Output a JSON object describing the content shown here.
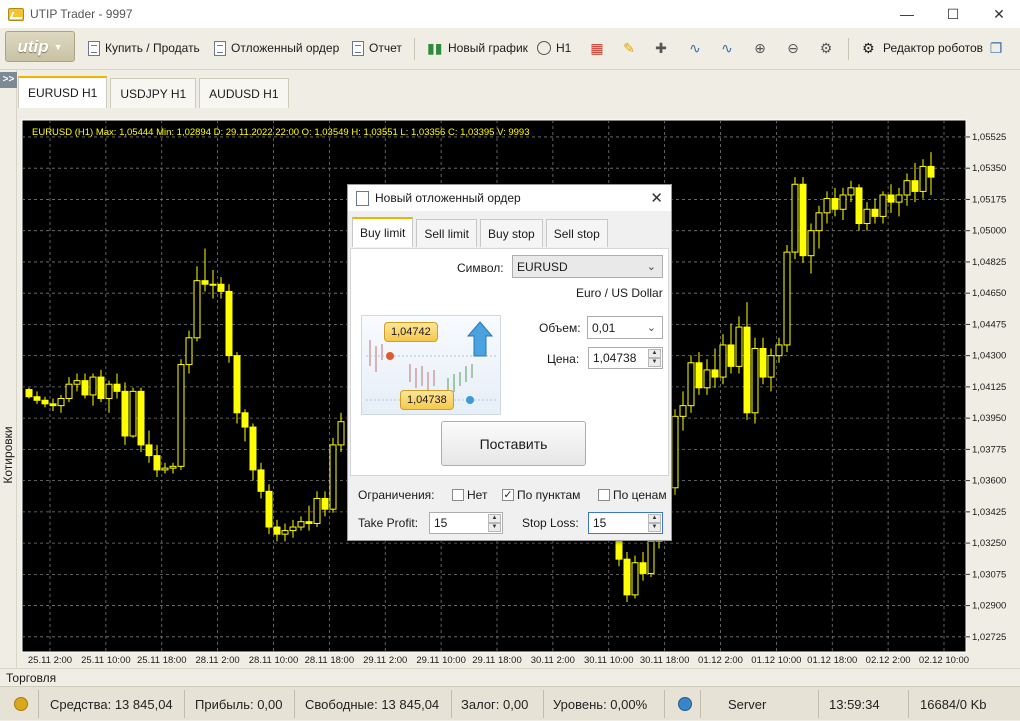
{
  "window": {
    "title": "UTIP Trader - 9997"
  },
  "toolbar": {
    "logo": "utip",
    "buy_sell": "Купить / Продать",
    "pending_order": "Отложенный ордер",
    "report": "Отчет",
    "new_chart": "Новый график",
    "timeframe": "H1",
    "robot_editor": "Редактор роботов"
  },
  "sidebar": {
    "quotes_label": "Котировки"
  },
  "tabs": [
    {
      "label": "EURUSD  H1"
    },
    {
      "label": "USDJPY  H1"
    },
    {
      "label": "AUDUSD  H1"
    }
  ],
  "chart_info": "EURUSD (H1)  Max: 1,05444  Min: 1,02894  D: 29.11.2022 22:00  O: 1,03549  H: 1,03551  L: 1,03356  C: 1,03395  V: 9993",
  "chart_data": {
    "type": "candlestick",
    "symbol": "EURUSD",
    "timeframe": "H1",
    "ylim": [
      1.0264,
      1.0562
    ],
    "y_ticks": [
      "1,05525",
      "1,05350",
      "1,05175",
      "1,05000",
      "1,04825",
      "1,04650",
      "1,04475",
      "1,04300",
      "1,04125",
      "1,03950",
      "1,03775",
      "1,03600",
      "1,03425",
      "1,03250",
      "1,03075",
      "1,02900",
      "1,02725"
    ],
    "y_tick_values": [
      1.05525,
      1.0535,
      1.05175,
      1.05,
      1.04825,
      1.0465,
      1.04475,
      1.043,
      1.04125,
      1.0395,
      1.03775,
      1.036,
      1.03425,
      1.0325,
      1.03075,
      1.029,
      1.02725
    ],
    "x_ticks": [
      "25.11 2:00",
      "25.11 10:00",
      "25.11 18:00",
      "28.11 2:00",
      "28.11 10:00",
      "28.11 18:00",
      "29.11 2:00",
      "29.11 10:00",
      "29.11 18:00",
      "30.11 2:00",
      "30.11 10:00",
      "30.11 18:00",
      "01.12 2:00",
      "01.12 10:00",
      "01.12 18:00",
      "02.12 2:00",
      "02.12 10:00"
    ],
    "grid": true,
    "candles": [
      [
        1.0411,
        1.0412,
        1.0406,
        1.0407
      ],
      [
        1.0407,
        1.041,
        1.0403,
        1.0405
      ],
      [
        1.0405,
        1.0407,
        1.0401,
        1.0403
      ],
      [
        1.0403,
        1.0406,
        1.0399,
        1.0402
      ],
      [
        1.0402,
        1.0408,
        1.0398,
        1.0406
      ],
      [
        1.0406,
        1.0418,
        1.0404,
        1.0414
      ],
      [
        1.0414,
        1.042,
        1.041,
        1.0416
      ],
      [
        1.0416,
        1.042,
        1.0406,
        1.0408
      ],
      [
        1.0408,
        1.042,
        1.0402,
        1.0418
      ],
      [
        1.0418,
        1.0422,
        1.0404,
        1.0406
      ],
      [
        1.0406,
        1.0416,
        1.0398,
        1.0414
      ],
      [
        1.0414,
        1.042,
        1.0406,
        1.041
      ],
      [
        1.041,
        1.0415,
        1.038,
        1.0385
      ],
      [
        1.0385,
        1.0412,
        1.0384,
        1.041
      ],
      [
        1.041,
        1.0412,
        1.0376,
        1.038
      ],
      [
        1.038,
        1.0388,
        1.037,
        1.0374
      ],
      [
        1.0374,
        1.038,
        1.0362,
        1.0366
      ],
      [
        1.0366,
        1.037,
        1.0364,
        1.0367
      ],
      [
        1.0367,
        1.037,
        1.0364,
        1.0368
      ],
      [
        1.0368,
        1.0428,
        1.0366,
        1.0425
      ],
      [
        1.0425,
        1.0444,
        1.042,
        1.044
      ],
      [
        1.044,
        1.048,
        1.0438,
        1.0472
      ],
      [
        1.0472,
        1.049,
        1.0466,
        1.047
      ],
      [
        1.047,
        1.0478,
        1.0462,
        1.047
      ],
      [
        1.047,
        1.0474,
        1.0462,
        1.0466
      ],
      [
        1.0466,
        1.047,
        1.0426,
        1.043
      ],
      [
        1.043,
        1.0432,
        1.0392,
        1.0398
      ],
      [
        1.0398,
        1.04,
        1.0382,
        1.039
      ],
      [
        1.039,
        1.0392,
        1.036,
        1.0366
      ],
      [
        1.0366,
        1.037,
        1.035,
        1.0354
      ],
      [
        1.0354,
        1.0358,
        1.033,
        1.0334
      ],
      [
        1.0334,
        1.0338,
        1.0326,
        1.033
      ],
      [
        1.033,
        1.0336,
        1.0326,
        1.0332
      ],
      [
        1.0332,
        1.0338,
        1.0328,
        1.0334
      ],
      [
        1.0334,
        1.034,
        1.0332,
        1.0337
      ],
      [
        1.0337,
        1.0346,
        1.0332,
        1.0336
      ],
      [
        1.0336,
        1.0354,
        1.0334,
        1.035
      ],
      [
        1.035,
        1.0354,
        1.034,
        1.0344
      ],
      [
        1.0344,
        1.0384,
        1.0342,
        1.038
      ],
      [
        1.038,
        1.0398,
        1.0376,
        1.0393
      ]
    ],
    "candles_right": [
      [
        1.033,
        1.0334,
        1.0312,
        1.0316
      ],
      [
        1.0316,
        1.032,
        1.0292,
        1.0296
      ],
      [
        1.0296,
        1.0318,
        1.0294,
        1.0314
      ],
      [
        1.0314,
        1.032,
        1.0304,
        1.0308
      ],
      [
        1.0308,
        1.033,
        1.0306,
        1.0326
      ],
      [
        1.0326,
        1.0345,
        1.0322,
        1.0338
      ],
      [
        1.0338,
        1.036,
        1.0334,
        1.0356
      ],
      [
        1.0356,
        1.04,
        1.0352,
        1.0396
      ],
      [
        1.0396,
        1.041,
        1.0388,
        1.0402
      ],
      [
        1.0402,
        1.043,
        1.0398,
        1.0426
      ],
      [
        1.0426,
        1.0432,
        1.0408,
        1.0412
      ],
      [
        1.0412,
        1.0428,
        1.0408,
        1.0422
      ],
      [
        1.0422,
        1.0434,
        1.0412,
        1.0418
      ],
      [
        1.0418,
        1.0442,
        1.0414,
        1.0436
      ],
      [
        1.0436,
        1.0448,
        1.042,
        1.0424
      ],
      [
        1.0424,
        1.0452,
        1.042,
        1.0446
      ],
      [
        1.0446,
        1.046,
        1.0394,
        1.0398
      ],
      [
        1.0398,
        1.044,
        1.0392,
        1.0434
      ],
      [
        1.0434,
        1.044,
        1.0414,
        1.0418
      ],
      [
        1.0418,
        1.0434,
        1.041,
        1.043
      ],
      [
        1.043,
        1.044,
        1.0426,
        1.0436
      ],
      [
        1.0436,
        1.0492,
        1.0432,
        1.0488
      ],
      [
        1.0488,
        1.053,
        1.0484,
        1.0526
      ],
      [
        1.0526,
        1.053,
        1.0482,
        1.0486
      ],
      [
        1.0486,
        1.0504,
        1.0476,
        1.05
      ],
      [
        1.05,
        1.0514,
        1.049,
        1.051
      ],
      [
        1.051,
        1.0522,
        1.0504,
        1.0518
      ],
      [
        1.0518,
        1.0524,
        1.0508,
        1.0512
      ],
      [
        1.0512,
        1.0524,
        1.0506,
        1.052
      ],
      [
        1.052,
        1.0528,
        1.0516,
        1.0524
      ],
      [
        1.0524,
        1.0526,
        1.05,
        1.0504
      ],
      [
        1.0504,
        1.0516,
        1.05,
        1.0512
      ],
      [
        1.0512,
        1.0518,
        1.0504,
        1.0508
      ],
      [
        1.0508,
        1.0522,
        1.0504,
        1.052
      ],
      [
        1.052,
        1.0526,
        1.051,
        1.0516
      ],
      [
        1.0516,
        1.0524,
        1.0508,
        1.052
      ],
      [
        1.052,
        1.0532,
        1.0514,
        1.0528
      ],
      [
        1.0528,
        1.0538,
        1.0516,
        1.0522
      ],
      [
        1.0522,
        1.054,
        1.0518,
        1.0536
      ],
      [
        1.0536,
        1.0544,
        1.052,
        1.053
      ]
    ]
  },
  "dialog": {
    "title": "Новый отложенный ордер",
    "tabs": [
      "Buy limit",
      "Sell limit",
      "Buy stop",
      "Sell stop"
    ],
    "symbol_label": "Символ:",
    "symbol_value": "EURUSD",
    "symbol_desc": "Euro / US Dollar",
    "volume_label": "Объем:",
    "volume_value": "0,01",
    "price_label": "Цена:",
    "price_value": "1,04738",
    "illus_price_top": "1,04742",
    "illus_price_bottom": "1,04738",
    "place_button": "Поставить",
    "limits_label": "Ограничения:",
    "opt_none": "Нет",
    "opt_points": "По пунктам",
    "opt_prices": "По ценам",
    "take_profit_label": "Take Profit:",
    "take_profit_value": "15",
    "stop_loss_label": "Stop Loss:",
    "stop_loss_value": "15"
  },
  "bottom": {
    "trading_label": "Торговля"
  },
  "status": {
    "funds": "Средства: 13 845,04",
    "profit": "Прибыль: 0,00",
    "free": "Свободные: 13 845,04",
    "margin": "Залог: 0,00",
    "level": "Уровень: 0,00%",
    "server": "Server",
    "time": "13:59:34",
    "traffic": "16684/0 Kb"
  },
  "colors": {
    "candle": "#ffff00",
    "chart_bg": "#000000",
    "grid": "#8a8a8a",
    "accent_tab": "#f0b400"
  }
}
